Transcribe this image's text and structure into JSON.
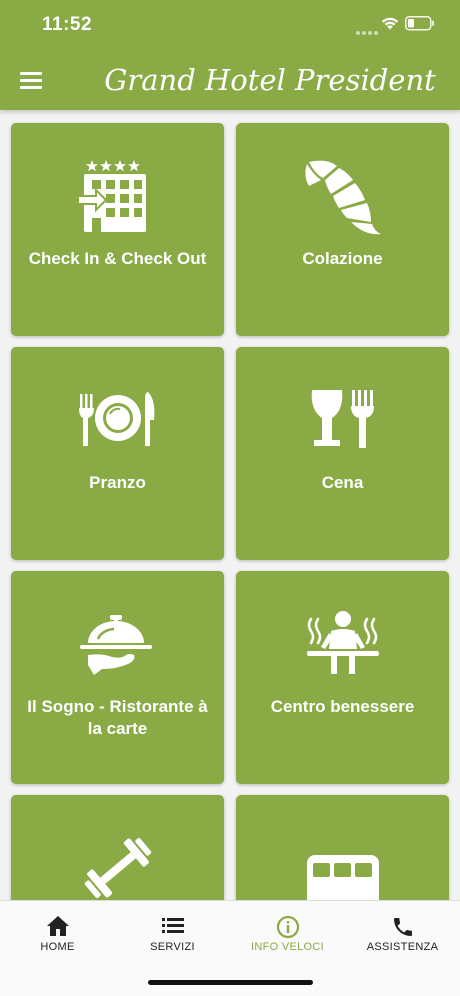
{
  "status_bar": {
    "time": "11:52"
  },
  "header": {
    "title": "Grand Hotel President"
  },
  "tiles": [
    {
      "label": "Check In & Check Out",
      "icon": "hotel-building-icon"
    },
    {
      "label": "Colazione",
      "icon": "croissant-icon"
    },
    {
      "label": "Pranzo",
      "icon": "plate-cutlery-icon"
    },
    {
      "label": "Cena",
      "icon": "wine-fork-icon"
    },
    {
      "label": "Il Sogno - Ristorante à la carte",
      "icon": "cloche-serving-icon"
    },
    {
      "label": "Centro benessere",
      "icon": "sauna-icon"
    },
    {
      "label": "",
      "icon": "dumbbell-icon"
    },
    {
      "label": "",
      "icon": "bus-icon"
    }
  ],
  "bottom_nav": {
    "items": [
      {
        "label": "HOME",
        "icon": "home-icon"
      },
      {
        "label": "SERVIZI",
        "icon": "list-icon"
      },
      {
        "label": "INFO VELOCI",
        "icon": "info-icon",
        "active": true
      },
      {
        "label": "ASSISTENZA",
        "icon": "phone-icon"
      }
    ]
  },
  "colors": {
    "accent": "#8aaa46",
    "background": "#f2f2f2"
  }
}
